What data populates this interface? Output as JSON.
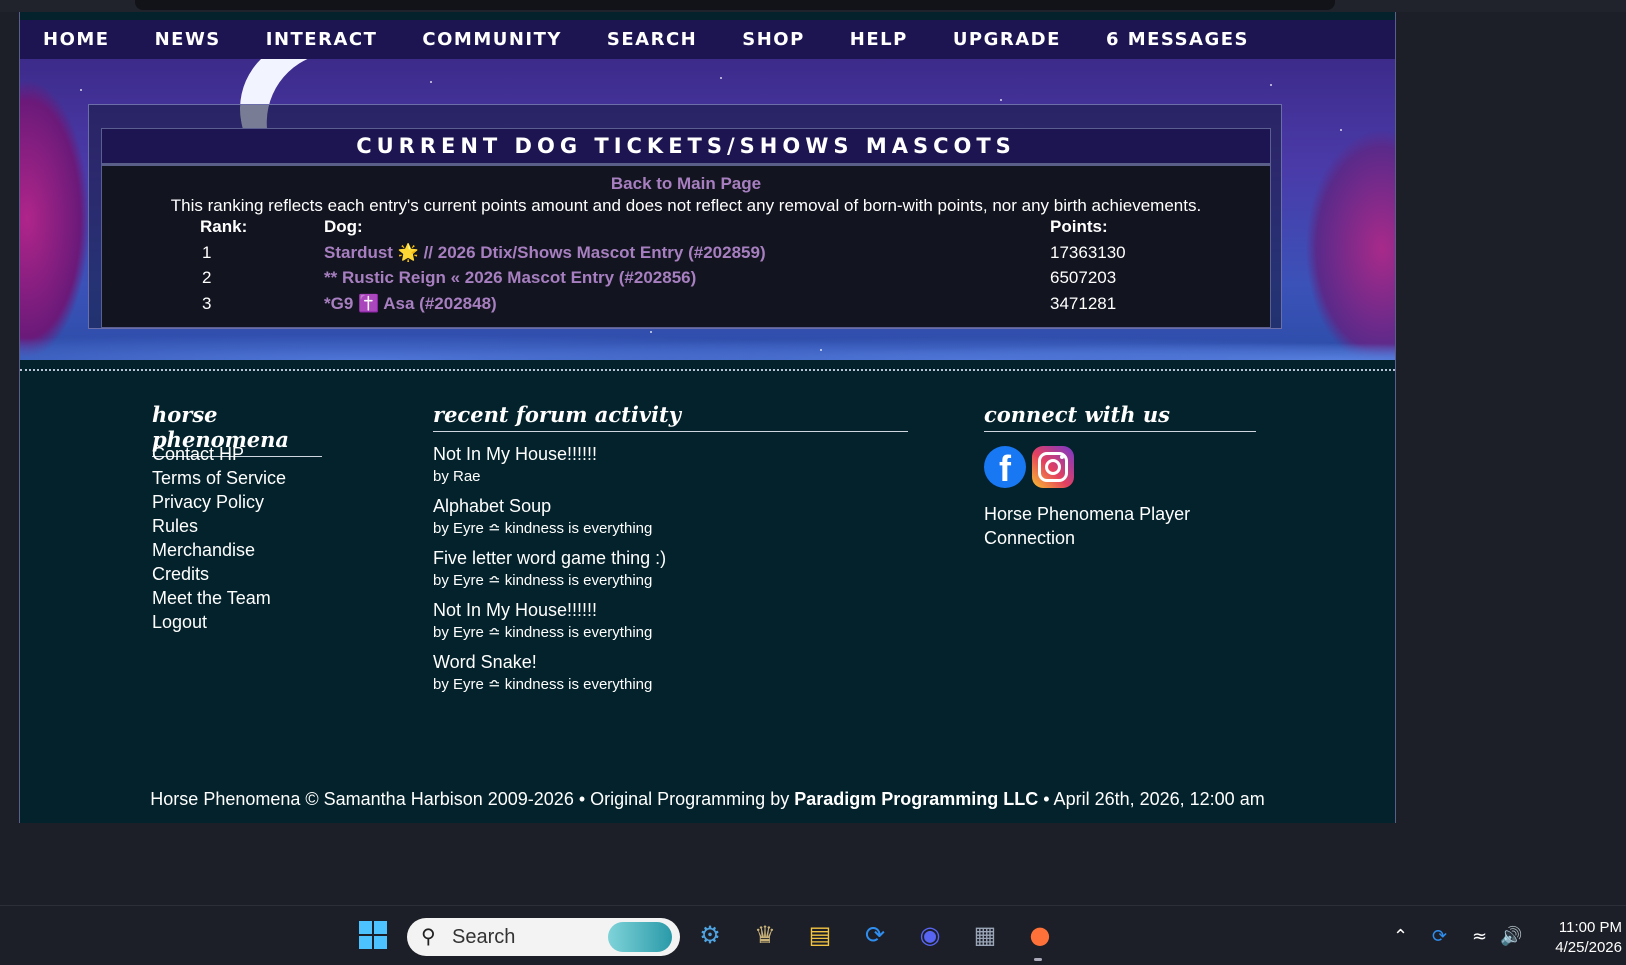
{
  "nav": [
    "HOME",
    "NEWS",
    "INTERACT",
    "COMMUNITY",
    "SEARCH",
    "SHOP",
    "HELP",
    "UPGRADE",
    "6 MESSAGES"
  ],
  "ranking": {
    "title": "CURRENT DOG TICKETS/SHOWS MASCOTS",
    "back_link": "Back to Main Page",
    "disclaimer": "This ranking reflects each entry's current points amount and does not reflect any removal of born-with points, nor any birth achievements.",
    "headers": {
      "rank": "Rank:",
      "dog": "Dog:",
      "points": "Points:"
    },
    "rows": [
      {
        "rank": "1",
        "dog": "Stardust 🌟 // 2026 Dtix/Shows Mascot Entry (#202859)",
        "points": "17363130"
      },
      {
        "rank": "2",
        "dog": "** Rustic Reign « 2026 Mascot Entry (#202856)",
        "points": "6507203"
      },
      {
        "rank": "3",
        "dog": "*G9 ✝️ Asa (#202848)",
        "points": "3471281"
      }
    ]
  },
  "footer": {
    "col1": {
      "heading": "horse phenomena",
      "links": [
        "Contact HP",
        "Terms of Service",
        "Privacy Policy",
        "Rules",
        "Merchandise",
        "Credits",
        "Meet the Team",
        "Logout"
      ]
    },
    "col2": {
      "heading": "recent forum activity",
      "items": [
        {
          "title": "Not In My House!!!!!!",
          "by": "by Rae"
        },
        {
          "title": "Alphabet Soup",
          "by": "by Eyre ≏ kindness is everything"
        },
        {
          "title": "Five letter word game thing :)",
          "by": "by Eyre ≏ kindness is everything"
        },
        {
          "title": "Not In My House!!!!!!",
          "by": "by Eyre ≏ kindness is everything"
        },
        {
          "title": "Word Snake!",
          "by": "by Eyre ≏ kindness is everything"
        }
      ]
    },
    "col3": {
      "heading": "connect with us",
      "icons": [
        "facebook-icon",
        "instagram-icon"
      ],
      "player_link": "Horse Phenomena Player Connection"
    },
    "copyright_pre": "Horse Phenomena © Samantha Harbison 2009-2026  •  Original Programming by ",
    "copyright_bold": "Paradigm Programming LLC",
    "copyright_post": "  •  April 26th, 2026, 12:00 am"
  },
  "taskbar": {
    "search_placeholder": "Search",
    "apps": [
      "windows-start-icon",
      "steam-icon",
      "game-icon",
      "file-explorer-icon",
      "sync-app-icon",
      "discord-icon",
      "calculator-icon",
      "firefox-icon"
    ],
    "time": "11:00 PM",
    "date": "4/25/2026"
  },
  "colors": {
    "nav_bg": "#1c1552",
    "link_purple": "#a77fc0",
    "footer_bg": "#03222b"
  }
}
